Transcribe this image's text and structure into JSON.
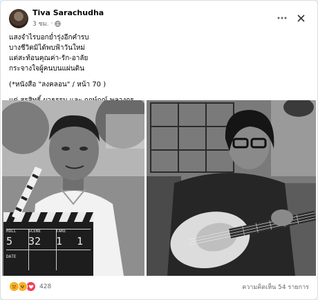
{
  "post": {
    "author": "Tiva Sarachudha",
    "time": "3 ชม.",
    "lines": [
      "แสงจำไรบอกย่ำรุ่งอีกคำรบ",
      "บางชีวิตมิได้พบฟ้าวันใหม่",
      "แต่สะท้อนคุณค่า-รัก-อาลัย",
      "กระจางใจผู้คนบนแผ่นดิน"
    ],
    "source_note": "(*หนังสือ \"ลงคลอน\" / หน้า 70 )",
    "dedication": "แด่ สุรสิทธิ์ ผาธรรม และ ฤกษ์ฤณ์ พลางกูร"
  },
  "slate": {
    "label_roll": "ROLL",
    "label_scene": "SCENE",
    "label_take": "TAKE",
    "label_date": "DATE",
    "roll": "5",
    "scene": "32",
    "take": "1",
    "number": "1"
  },
  "footer": {
    "reaction_count": "428",
    "comments": "ความคิดเห็น 54 รายการ"
  },
  "icons": {
    "header": [
      "globe-icon",
      "more-icon",
      "close-icon"
    ],
    "reactions": [
      "sad-icon",
      "haha-icon",
      "love-icon"
    ]
  },
  "colors": {
    "author_text": "#050505",
    "secondary_text": "#65676b",
    "love": "#f33e58",
    "reaction_yellow": "#f7b125"
  }
}
